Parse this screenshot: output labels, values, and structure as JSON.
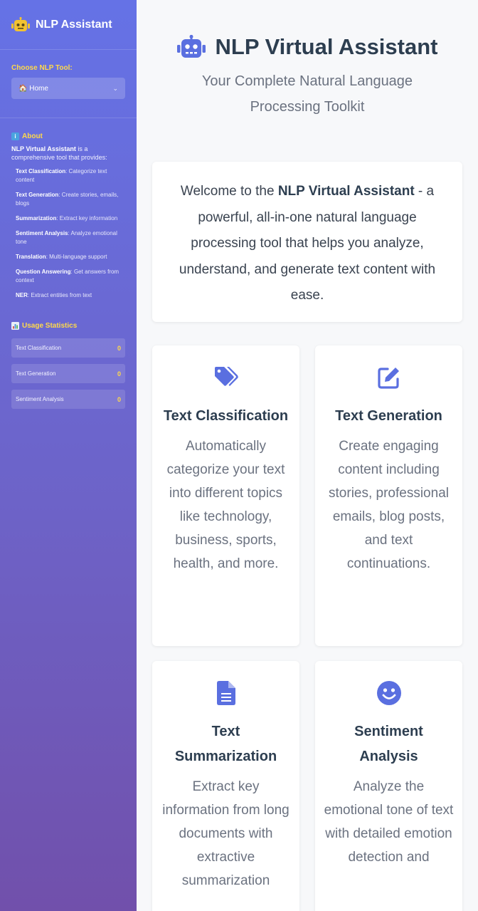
{
  "sidebar": {
    "title": "NLP Assistant",
    "choose_label": "Choose NLP Tool:",
    "selected_tool": "🏠 Home",
    "about": {
      "heading": "About",
      "intro_name": "NLP Virtual Assistant",
      "intro_rest": " is a comprehensive tool that provides:",
      "items": [
        {
          "name": "Text Classification",
          "desc": ": Categorize text content"
        },
        {
          "name": "Text Generation",
          "desc": ": Create stories, emails, blogs"
        },
        {
          "name": "Summarization",
          "desc": ": Extract key information"
        },
        {
          "name": "Sentiment Analysis",
          "desc": ": Analyze emotional tone"
        },
        {
          "name": "Translation",
          "desc": ": Multi-language support"
        },
        {
          "name": "Question Answering",
          "desc": ": Get answers from context"
        },
        {
          "name": "NER",
          "desc": ": Extract entities from text"
        }
      ]
    },
    "stats": {
      "heading": "Usage Statistics",
      "rows": [
        {
          "label": "Text Classification",
          "value": "0"
        },
        {
          "label": "Text Generation",
          "value": "0"
        },
        {
          "label": "Sentiment Analysis",
          "value": "0"
        }
      ]
    }
  },
  "main": {
    "title": "NLP Virtual Assistant",
    "subtitle": "Your Complete Natural Language Processing Toolkit",
    "welcome": {
      "pre": "Welcome to the ",
      "name": "NLP Virtual Assistant",
      "post": " - a powerful, all-in-one natural language processing tool that helps you analyze, understand, and generate text content with ease."
    },
    "cards": [
      {
        "icon": "tag-icon",
        "title": "Text Classification",
        "desc": "Automatically categorize your text into different topics like technology, business, sports, health, and more."
      },
      {
        "icon": "edit-icon",
        "title": "Text Generation",
        "desc": "Create engaging content including stories, professional emails, blog posts, and text continuations."
      },
      {
        "icon": "document-icon",
        "title": "Text Summarization",
        "desc": "Extract key information from long documents with extractive summarization"
      },
      {
        "icon": "smile-icon",
        "title": "Sentiment Analysis",
        "desc": "Analyze the emotional tone of text with detailed emotion detection and"
      }
    ]
  },
  "colors": {
    "accent": "#5a6fe0",
    "yellow": "#ffd94a",
    "robot": "#f2c230"
  }
}
